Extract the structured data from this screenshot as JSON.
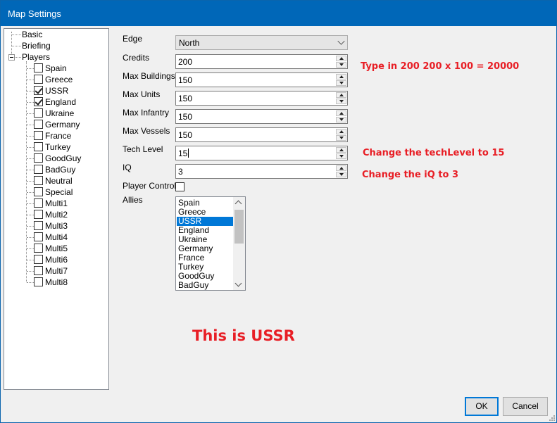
{
  "window": {
    "title": "Map Settings"
  },
  "tree": {
    "basic": "Basic",
    "briefing": "Briefing",
    "players_label": "Players",
    "players": [
      {
        "label": "Spain",
        "checked": false
      },
      {
        "label": "Greece",
        "checked": false
      },
      {
        "label": "USSR",
        "checked": true
      },
      {
        "label": "England",
        "checked": true
      },
      {
        "label": "Ukraine",
        "checked": false
      },
      {
        "label": "Germany",
        "checked": false
      },
      {
        "label": "France",
        "checked": false
      },
      {
        "label": "Turkey",
        "checked": false
      },
      {
        "label": "GoodGuy",
        "checked": false
      },
      {
        "label": "BadGuy",
        "checked": false
      },
      {
        "label": "Neutral",
        "checked": false
      },
      {
        "label": "Special",
        "checked": false
      },
      {
        "label": "Multi1",
        "checked": false
      },
      {
        "label": "Multi2",
        "checked": false
      },
      {
        "label": "Multi3",
        "checked": false
      },
      {
        "label": "Multi4",
        "checked": false
      },
      {
        "label": "Multi5",
        "checked": false
      },
      {
        "label": "Multi6",
        "checked": false
      },
      {
        "label": "Multi7",
        "checked": false
      },
      {
        "label": "Multi8",
        "checked": false
      }
    ]
  },
  "form": {
    "edge": {
      "label": "Edge",
      "value": "North"
    },
    "credits": {
      "label": "Credits",
      "value": "200"
    },
    "max_buildings": {
      "label": "Max Buildings",
      "value": "150"
    },
    "max_units": {
      "label": "Max Units",
      "value": "150"
    },
    "max_infantry": {
      "label": "Max Infantry",
      "value": "150"
    },
    "max_vessels": {
      "label": "Max Vessels",
      "value": "150"
    },
    "tech_level": {
      "label": "Tech Level",
      "value": "15"
    },
    "iq": {
      "label": "IQ",
      "value": "3"
    },
    "player_control": {
      "label": "Player Control",
      "checked": false
    },
    "allies": {
      "label": "Allies",
      "items": [
        "Spain",
        "Greece",
        "USSR",
        "England",
        "Ukraine",
        "Germany",
        "France",
        "Turkey",
        "GoodGuy",
        "BadGuy"
      ],
      "selected": "USSR"
    }
  },
  "annotations": {
    "credits_note": "Type in 200 200 x 100 = 20000",
    "tech_note": "Change the techLevel to 15",
    "iq_note": "Change the iQ to 3",
    "player_note": "This is USSR",
    "color": "#e81e25"
  },
  "buttons": {
    "ok": "OK",
    "cancel": "Cancel"
  }
}
